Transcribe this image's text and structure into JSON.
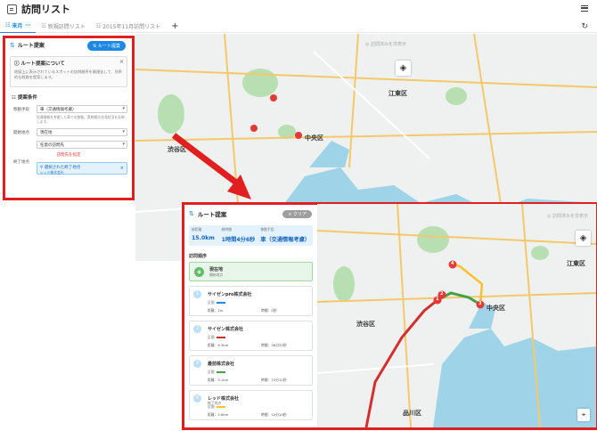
{
  "back_screen": {
    "app_title": "訪問リスト",
    "tabs": [
      {
        "label": "来月",
        "active": true
      },
      {
        "label": "新規訪問リスト",
        "active": false
      },
      {
        "label": "2015年11月訪問リスト",
        "active": false
      }
    ],
    "add_tab": "+",
    "sidebar": {
      "title": "ルート提案",
      "action_button": "ルート提案",
      "info_title": "ルート提案について",
      "info_body": "地図上に表示されているスポットの訪問順序を最適化して、効率的な経路を提案します。",
      "conditions_title": "提案条件",
      "transport_label": "移動手段",
      "transport_value": "車（交通情報考慮）",
      "transport_note": "交通情報を考慮した車での移動。実時間の渋滞状況を反映します。",
      "start_label": "開始地点",
      "start_value": "現在地",
      "next_value": "任意の訪問先",
      "reset_link": "訪問先を指定",
      "end_label": "終了地点",
      "end_value": "選択された終了地点",
      "end_sub": "レッド株式会社"
    },
    "map": {
      "hide_label": "訪問済みを非表示",
      "labels": [
        "渋谷区",
        "中央区",
        "江東区"
      ]
    }
  },
  "front_screen": {
    "sidebar": {
      "title": "ルート提案",
      "clear_button": "クリア",
      "stats": [
        {
          "label": "総距離",
          "value": "15.0km"
        },
        {
          "label": "総時間",
          "value": "1時間4分6秒"
        },
        {
          "label": "移動手段",
          "value": "車（交通情報考慮）"
        }
      ],
      "order_title": "訪問順序",
      "start": {
        "name": "現在地",
        "sub": "開始地点"
      },
      "stops": [
        {
          "num": "1",
          "name": "サイゼンpro株式会社",
          "sub": "",
          "leg_label": "区間",
          "distance": "距離：1m",
          "time": "時間：0秒",
          "color": "#1e88e5"
        },
        {
          "num": "2",
          "name": "サイゼン株式会社",
          "sub": "",
          "leg_label": "区間",
          "distance": "距離：9.3km",
          "time": "時間：36分35秒",
          "color": "#d32f2f"
        },
        {
          "num": "3",
          "name": "最前株式会社",
          "sub": "",
          "leg_label": "区間",
          "distance": "距離：3.1km",
          "time": "時間：15分12秒",
          "color": "#43a047"
        },
        {
          "num": "4",
          "name": "レッド株式会社",
          "sub": "終了地点",
          "leg_label": "区間",
          "distance": "距離：2.6km",
          "time": "時間：12分19秒",
          "color": "#fbc02d"
        }
      ]
    },
    "map": {
      "hide_label": "訪問済みを非表示",
      "labels": [
        "中央区",
        "江東区",
        "渋谷区",
        "品川区"
      ],
      "pin_numbers": [
        "1",
        "2",
        "3",
        "4"
      ]
    }
  },
  "colors": {
    "accent": "#1e88e5",
    "highlight_frame": "#e02020",
    "route_red": "#d32f2f",
    "route_green": "#43a047",
    "route_yellow": "#fbc02d",
    "water": "#9fd3e8",
    "park": "#b7dfb1"
  }
}
